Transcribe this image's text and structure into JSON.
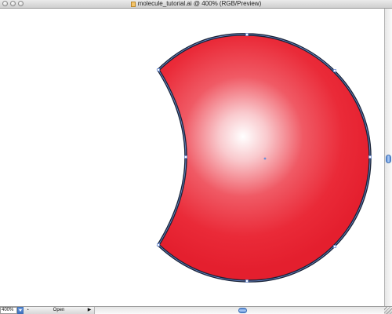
{
  "window": {
    "title": "molecule_tutorial.ai @ 400% (RGB/Preview)",
    "doc_icon": "document-icon"
  },
  "artwork": {
    "fill_center_color": "#ffffff",
    "fill_edge_color": "#e8212f",
    "stroke_color": "#1a2438",
    "selection_color": "#6e8fd6"
  },
  "statusbar": {
    "zoom": "400%",
    "status": "Open",
    "status_icon": "info-icon",
    "menu_icon": "triangle-right-icon"
  },
  "scrollbars": {
    "vertical": "scrollbar",
    "horizontal": "scrollbar"
  }
}
